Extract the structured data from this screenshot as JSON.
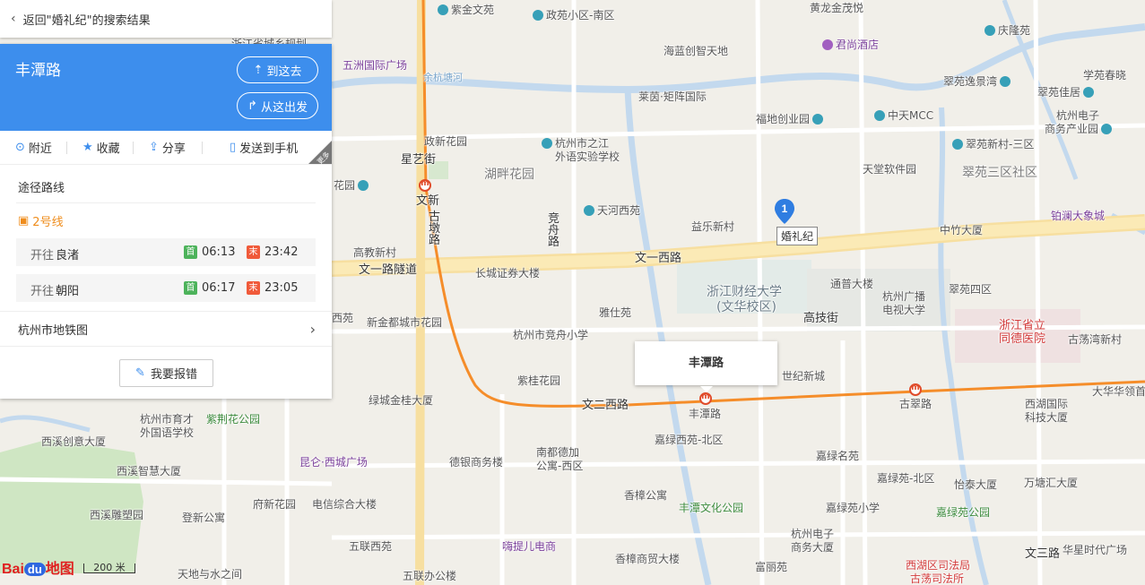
{
  "panel": {
    "back_label": "返回\"婚礼纪\"的搜索结果",
    "title": "丰潭路",
    "go_here": "到这去",
    "from_here": "从这出发",
    "actions": {
      "nearby": "附近",
      "favorite": "收藏",
      "share": "分享",
      "send_to_phone": "发送到手机",
      "more": "更多"
    },
    "routes_title": "途径路线",
    "line_name": "2号线",
    "stops": [
      {
        "direction": "开往",
        "terminus": "良渚",
        "first_badge": "首",
        "first_time": "06:13",
        "last_badge": "末",
        "last_time": "23:42"
      },
      {
        "direction": "开往",
        "terminus": "朝阳",
        "first_badge": "首",
        "first_time": "06:17",
        "last_badge": "末",
        "last_time": "23:05"
      }
    ],
    "metro_map_link": "杭州市地铁图",
    "report_button": "我要报错"
  },
  "map": {
    "popup_title": "丰潭路",
    "marker_number": "1",
    "marker_label": "婚礼纪",
    "scale_label": "200 米",
    "logo_text": "Bai",
    "logo_du": "du",
    "logo_suffix": "地图",
    "labels": {
      "l01": "紫金文苑",
      "l02": "政苑小区-南区",
      "l03": "黄龙金茂悦",
      "l04": "庆隆苑",
      "l05": "浙江省城乡规划",
      "l06": "五洲国际广场",
      "l07": "海蓝创智天地",
      "l08": "君尚酒店",
      "l09": "余杭塘河",
      "l10": "莱茵·矩阵国际",
      "l11": "翠苑逸景湾",
      "l12": "学苑春晓",
      "l13": "翠苑佳居",
      "l14": "福地创业园",
      "l15": "中天MCC",
      "l16": "杭州电子",
      "l17": "商务产业园",
      "l18": "政新花园",
      "l19": "杭州市之江",
      "l20": "外语实验学校",
      "l21": "翠苑新村-三区",
      "l22": "星艺街",
      "l23": "天堂软件园",
      "l24": "翠苑三区社区",
      "l25": "湖畔花园",
      "l26": "花园",
      "l27": "文新",
      "l28": "天河西苑",
      "l29": "竞",
      "l30": "舟",
      "l31": "路",
      "l32": "古",
      "l33": "墩",
      "l34": "路2",
      "l35": "益乐新村",
      "l36": "铂澜大象城",
      "l37": "中竹大厦",
      "l38": "高教新村",
      "l39": "文一西路",
      "l40": "文一路隧道",
      "l41": "长城证券大楼",
      "l42": "通普大楼",
      "l43": "浙江财经大学",
      "l44": "(文华校区)",
      "l45": "杭州广播",
      "l46": "电视大学",
      "l47": "翠苑四区",
      "l48": "雅仕苑",
      "l49": "高技街",
      "l50": "新金都城市花园",
      "l51": "西苑",
      "l52": "浙江省立",
      "l53": "同德医院",
      "l54": "杭州市竞舟小学",
      "l55": "古荡湾新村",
      "l56": "世纪新城",
      "l57": "紫桂花园",
      "l58": "绿城金桂大厦",
      "l59": "文二西路",
      "l60": "丰潭路",
      "l61": "古翠路",
      "l62": "西湖国际",
      "l63": "科技大厦",
      "l64": "大华华领首",
      "l65": "杭州市育才",
      "l66": "外国语学校",
      "l67": "紫荆花公园",
      "l68": "嘉绿西苑-北区",
      "l69": "西溪创意大厦",
      "l70": "南都德加",
      "l71": "公寓-西区",
      "l72": "昆仑·西城广场",
      "l73": "德银商务楼",
      "l74": "嘉绿名苑",
      "l75": "西溪智慧大厦",
      "l76": "嘉绿苑-北区",
      "l77": "怡泰大厦",
      "l78": "万塘汇大厦",
      "l79": "香樟公寓",
      "l80": "丰潭文化公园",
      "l81": "西溪雕塑园",
      "l82": "府新花园",
      "l83": "电信综合大楼",
      "l84": "登新公寓",
      "l85": "嘉绿苑小学",
      "l86": "嘉绿苑公园",
      "l87": "五联西苑",
      "l88": "嗨提儿电商",
      "l89": "杭州电子",
      "l90": "商务大厦",
      "l91": "华星时代广场",
      "l92": "文三路",
      "l93": "天地与水之间",
      "l94": "五联办公楼",
      "l95": "香樟商贸大楼",
      "l96": "富丽苑",
      "l97": "西湖区司法局",
      "l98": "古荡司法所"
    }
  }
}
